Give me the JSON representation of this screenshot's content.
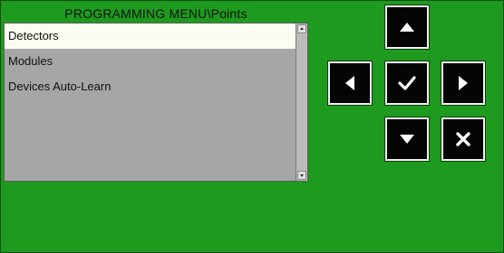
{
  "menu": {
    "title": "PROGRAMMING MENU\\Points",
    "selected_index": 0,
    "items": [
      {
        "label": "Detectors"
      },
      {
        "label": "Modules"
      },
      {
        "label": "Devices Auto-Learn"
      }
    ]
  },
  "colors": {
    "background": "#1e9a1e",
    "panel": "#a6a6a6",
    "selected_row": "#fbfbf1",
    "button": "#050505",
    "button_border": "#f2f2f2"
  },
  "keypad": {
    "up_icon": "arrow-up-icon",
    "left_icon": "arrow-left-icon",
    "ok_icon": "checkmark-icon",
    "right_icon": "arrow-right-icon",
    "down_icon": "arrow-down-icon",
    "cancel_icon": "cancel-x-icon"
  }
}
